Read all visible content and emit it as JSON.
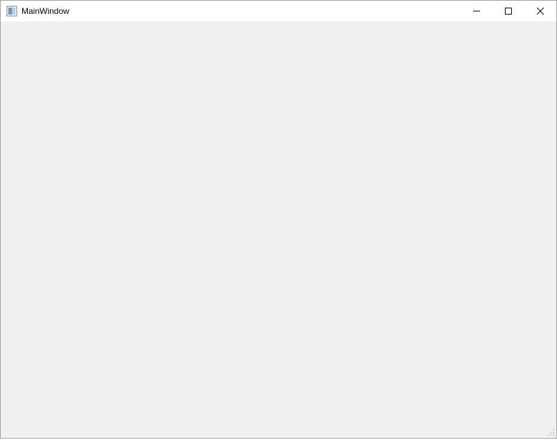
{
  "window": {
    "title": "MainWindow"
  }
}
